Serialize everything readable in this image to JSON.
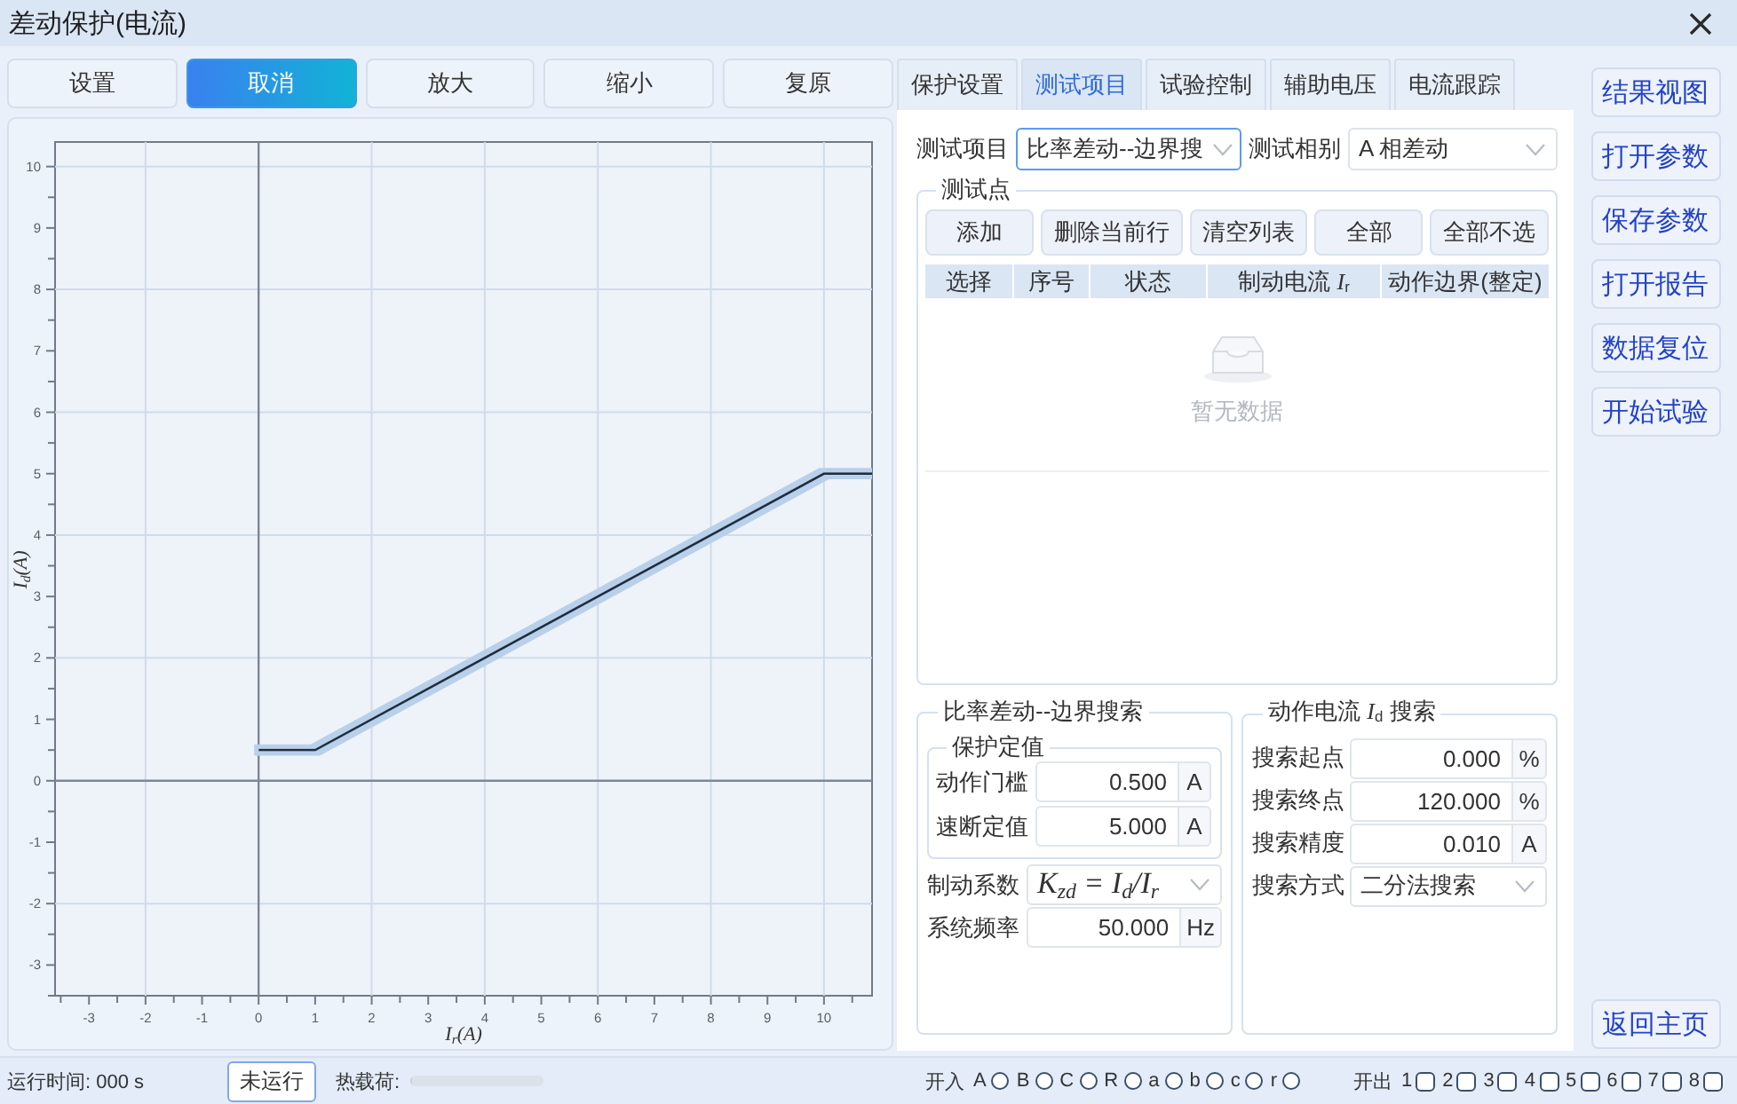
{
  "window": {
    "title": "差动保护(电流)"
  },
  "toolbar": [
    {
      "label": "设置",
      "active": false
    },
    {
      "label": "取消",
      "active": true
    },
    {
      "label": "放大",
      "active": false
    },
    {
      "label": "缩小",
      "active": false
    },
    {
      "label": "复原",
      "active": false
    }
  ],
  "chart": {
    "chart_data": {
      "type": "line",
      "xlabel": "I$_{r}$(A)",
      "ylabel": "I$_{d}$(A)",
      "x": [
        0,
        1,
        10,
        10.85
      ],
      "series": [
        {
          "color": "#1e2d40",
          "values": [
            0.5,
            0.5,
            5,
            5
          ]
        }
      ],
      "xlim": [
        -3.6,
        10.85
      ],
      "ylim": [
        -3.5,
        10.4
      ],
      "xticks": [
        -3,
        -2,
        -1,
        0,
        1,
        2,
        3,
        4,
        5,
        6,
        7,
        8,
        9,
        10
      ],
      "yticks": [
        -3,
        -2,
        -1,
        0,
        1,
        2,
        3,
        4,
        5,
        6,
        7,
        8,
        9,
        10
      ],
      "grid": true
    }
  },
  "tabs": [
    {
      "label": "保护设置",
      "selected": false
    },
    {
      "label": "测试项目",
      "selected": true
    },
    {
      "label": "试验控制",
      "selected": false
    },
    {
      "label": "辅助电压",
      "selected": false
    },
    {
      "label": "电流跟踪",
      "selected": false
    }
  ],
  "test_item": {
    "label": "测试项目",
    "value": "比率差动--边界搜",
    "focused": true
  },
  "test_phase": {
    "label": "测试相别",
    "value": "A 相差动",
    "focused": false
  },
  "test_points": {
    "legend": "测试点",
    "buttons": [
      "添加",
      "删除当前行",
      "清空列表",
      "全部",
      "全部不选"
    ],
    "columns": [
      "选择",
      "序号",
      "状态",
      "制动电流 *I*$_{r}$",
      "动作边界(整定)"
    ],
    "empty_text": "暂无数据"
  },
  "boundary_search": {
    "legend": "比率差动--边界搜索",
    "settings": {
      "legend": "保护定值",
      "fields": [
        {
          "label": "动作门槛",
          "value": "0.500",
          "unit": "A"
        },
        {
          "label": "速断定值",
          "value": "5.000",
          "unit": "A"
        }
      ]
    },
    "fields": [
      {
        "kind": "formula",
        "label": "制动系数",
        "value": "K$_{zd}$ = I$_{d}$/I$_{r}$"
      },
      {
        "kind": "input",
        "label": "系统频率",
        "value": "50.000",
        "unit": "Hz"
      }
    ]
  },
  "current_search": {
    "legend": "动作电流 *I*$_{d}$ 搜索",
    "fields": [
      {
        "kind": "input",
        "label": "搜索起点",
        "value": "0.000",
        "unit": "%"
      },
      {
        "kind": "input",
        "label": "搜索终点",
        "value": "120.000",
        "unit": "%"
      },
      {
        "kind": "input",
        "label": "搜索精度",
        "value": "0.010",
        "unit": "A"
      },
      {
        "kind": "select",
        "label": "搜索方式",
        "value": "二分法搜索"
      }
    ]
  },
  "side_buttons": [
    "结果视图",
    "打开参数",
    "保存参数",
    "打开报告",
    "数据复位",
    "开始试验"
  ],
  "home_button": "返回主页",
  "status_bar": {
    "run_time": "运行时间: 000 s",
    "run_state": "未运行",
    "heat_load": {
      "label": "热载荷:",
      "level": 0
    },
    "inputs": {
      "label": "开入",
      "items": [
        {
          "label": "A",
          "on": false
        },
        {
          "label": "B",
          "on": false
        },
        {
          "label": "C",
          "on": false
        },
        {
          "label": "R",
          "on": false
        },
        {
          "label": "a",
          "on": false
        },
        {
          "label": "b",
          "on": false
        },
        {
          "label": "c",
          "on": false
        },
        {
          "label": "r",
          "on": false
        }
      ]
    },
    "outputs": {
      "label": "开出",
      "items": [
        {
          "label": "1",
          "on": false
        },
        {
          "label": "2",
          "on": false
        },
        {
          "label": "3",
          "on": false
        },
        {
          "label": "4",
          "on": false
        },
        {
          "label": "5",
          "on": false
        },
        {
          "label": "6",
          "on": false
        },
        {
          "label": "7",
          "on": false
        },
        {
          "label": "8",
          "on": false
        }
      ]
    }
  }
}
